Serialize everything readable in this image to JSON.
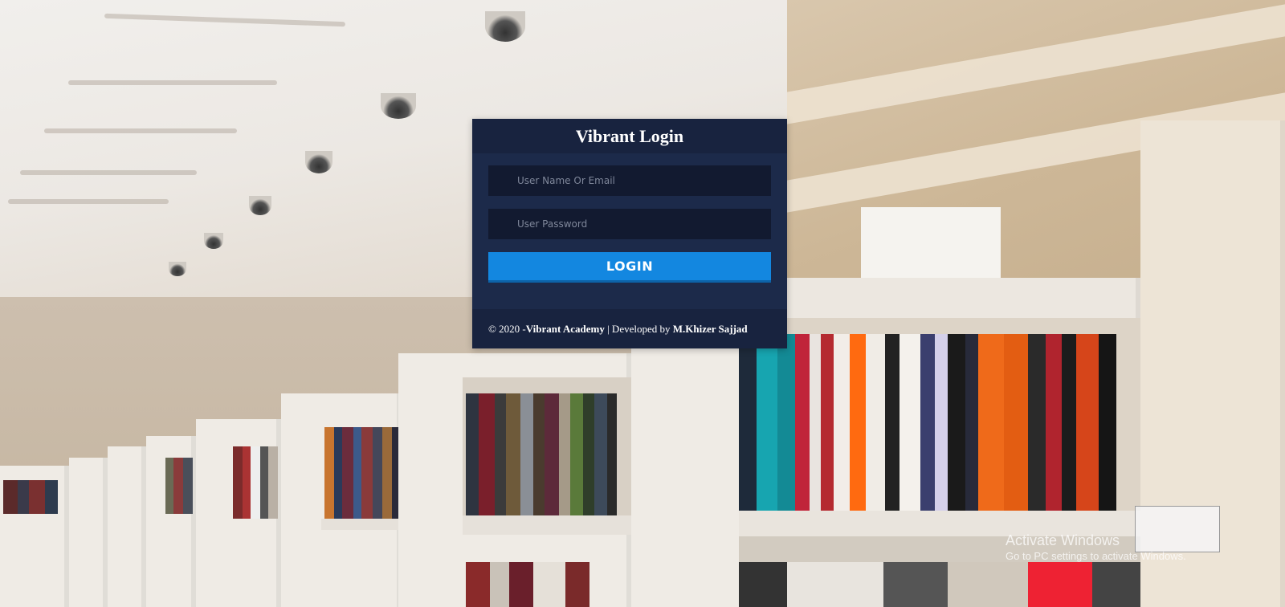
{
  "login": {
    "title": "Vibrant Login",
    "username_placeholder": "User Name Or Email",
    "password_placeholder": "User Password",
    "button_label": "LOGIN"
  },
  "footer": {
    "copyright": "© 2020 - ",
    "academy": "Vibrant Academy",
    "developed_prefix": " | Developed by ",
    "developer": "M.Khizer Sajjad"
  },
  "watermark": {
    "line1": "Activate Windows",
    "line2": "Go to PC settings to activate Windows."
  },
  "colors": {
    "card_bg": "#1c2a4a",
    "header_bg": "#18233f",
    "input_bg": "#121a30",
    "button_bg": "#1387e0"
  }
}
